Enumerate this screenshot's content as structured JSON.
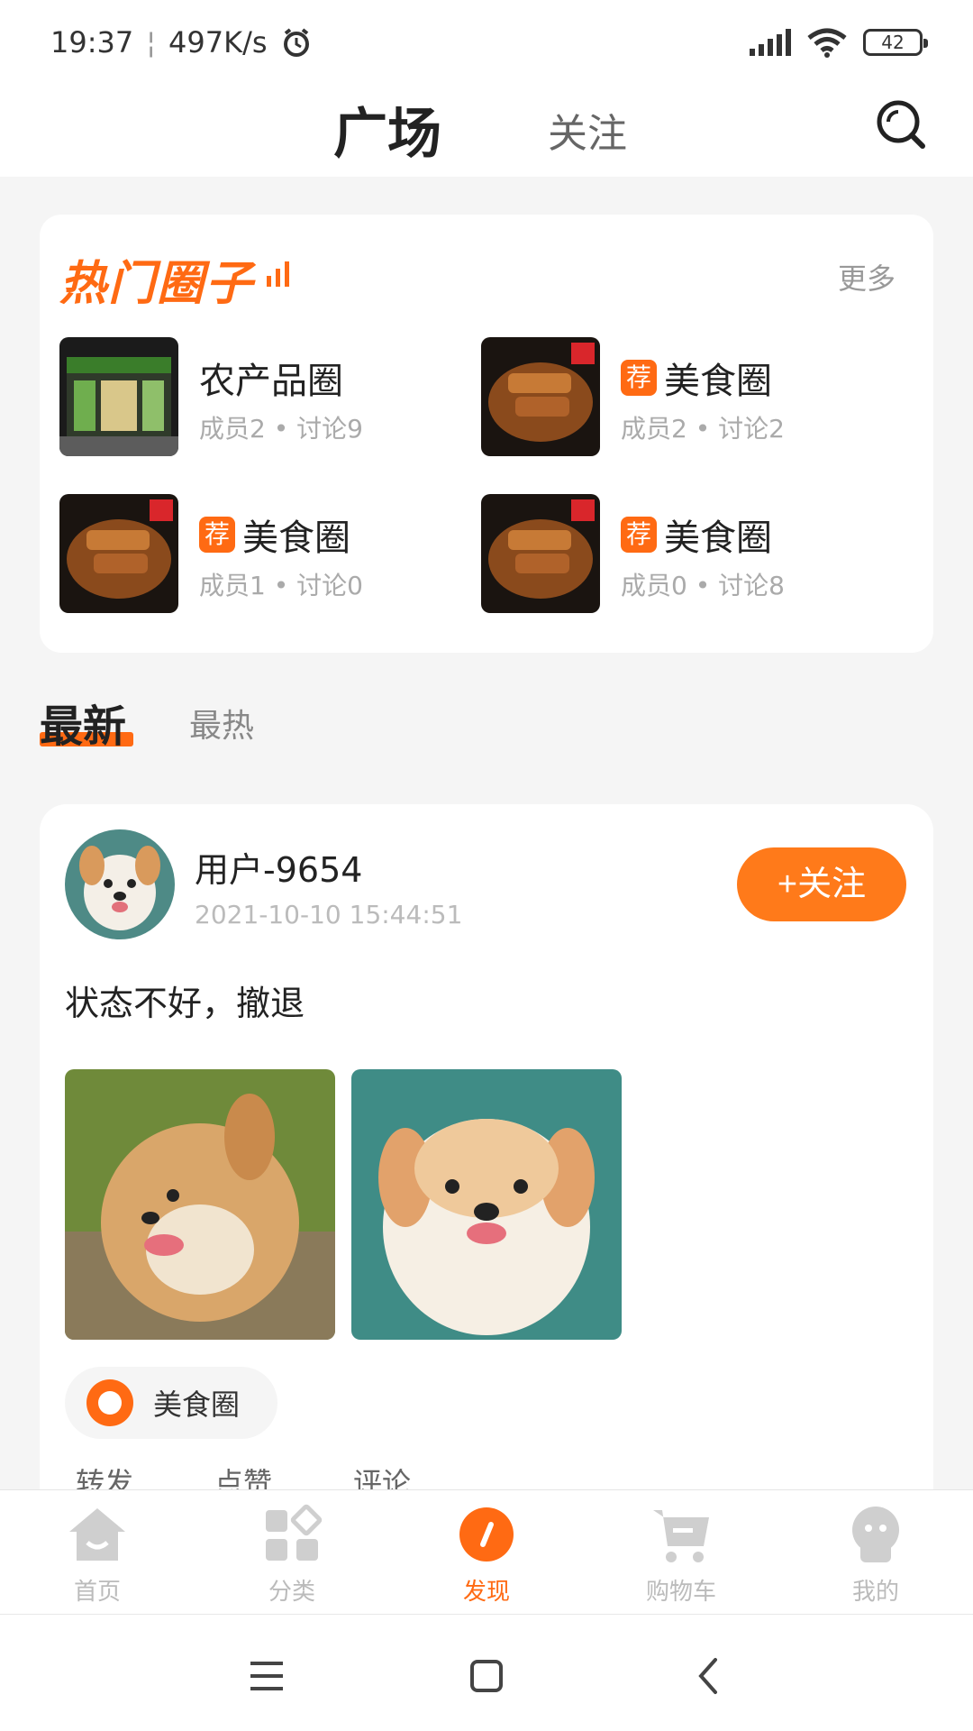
{
  "status_bar": {
    "time": "19:37",
    "net_speed": "497K/s",
    "battery": "42",
    "icons": [
      "alarm-icon",
      "signal-icon",
      "wifi-icon",
      "battery-icon"
    ]
  },
  "header": {
    "tab_active": "广场",
    "tab_other": "关注",
    "search_icon": "search-icon"
  },
  "hot_circles": {
    "title": "热门圈子",
    "more": "更多",
    "items": [
      {
        "name": "农产品圈",
        "recommended": false,
        "meta": "成员2 • 讨论9",
        "thumb": "store-image"
      },
      {
        "name": "美食圈",
        "recommended": true,
        "badge": "荐",
        "meta": "成员2 • 讨论2",
        "thumb": "food-image"
      },
      {
        "name": "美食圈",
        "recommended": true,
        "badge": "荐",
        "meta": "成员1 • 讨论0",
        "thumb": "food-image"
      },
      {
        "name": "美食圈",
        "recommended": true,
        "badge": "荐",
        "meta": "成员0 • 讨论8",
        "thumb": "food-image"
      }
    ]
  },
  "feed_tabs": {
    "active": "最新",
    "other": "最热"
  },
  "post": {
    "username": "用户-9654",
    "time": "2021-10-10 15:44:51",
    "follow_label": "+关注",
    "text": "状态不好，撤退",
    "circle_tag": "美食圈",
    "actions": [
      "转发",
      "点赞",
      "评论"
    ]
  },
  "bottom_nav": {
    "items": [
      {
        "label": "首页",
        "icon": "home-icon",
        "active": false
      },
      {
        "label": "分类",
        "icon": "category-icon",
        "active": false
      },
      {
        "label": "发现",
        "icon": "discover-icon",
        "active": true
      },
      {
        "label": "购物车",
        "icon": "cart-icon",
        "active": false
      },
      {
        "label": "我的",
        "icon": "profile-icon",
        "active": false
      }
    ]
  },
  "colors": {
    "accent": "#ff6a13",
    "follow_btn": "#ff7a1a"
  }
}
